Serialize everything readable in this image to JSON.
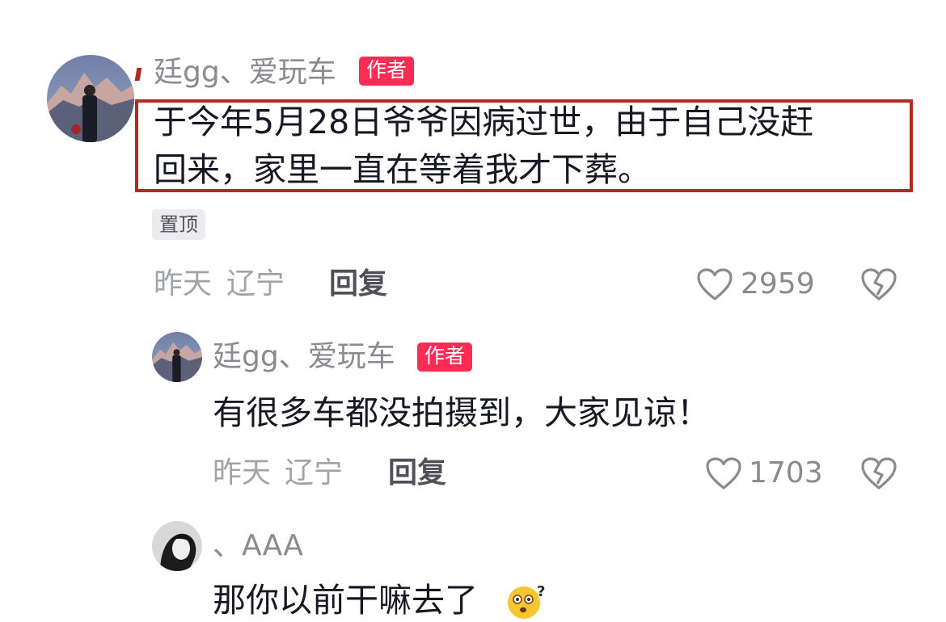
{
  "comments": [
    {
      "username": "廷gg、爱玩车",
      "badge": "作者",
      "text_line1": "于今年5月28日爷爷因病过世，由于自己没赶",
      "text_line2": "回来，家里一直在等着我才下葬。",
      "pinned_label": "置顶",
      "time": "昨天",
      "location": "辽宁",
      "reply_label": "回复",
      "like_count": "2959",
      "avatar": "mountain-man-avatar"
    }
  ],
  "replies": [
    {
      "username": "廷gg、爱玩车",
      "badge": "作者",
      "text": "有很多车都没拍摄到，大家见谅！",
      "time": "昨天",
      "location": "辽宁",
      "reply_label": "回复",
      "like_count": "1703",
      "avatar": "mountain-man-avatar"
    },
    {
      "username": "、AAA",
      "text": "那你以前干嘛去了",
      "emoji": "🤔",
      "avatar": "bw-portrait-avatar"
    }
  ],
  "colors": {
    "accent_badge": "#fe2c55",
    "highlight_border": "#b22a22",
    "muted_text": "#8a8b91"
  },
  "icons": [
    "heart-outline-icon",
    "dislike-broken-heart-icon"
  ]
}
